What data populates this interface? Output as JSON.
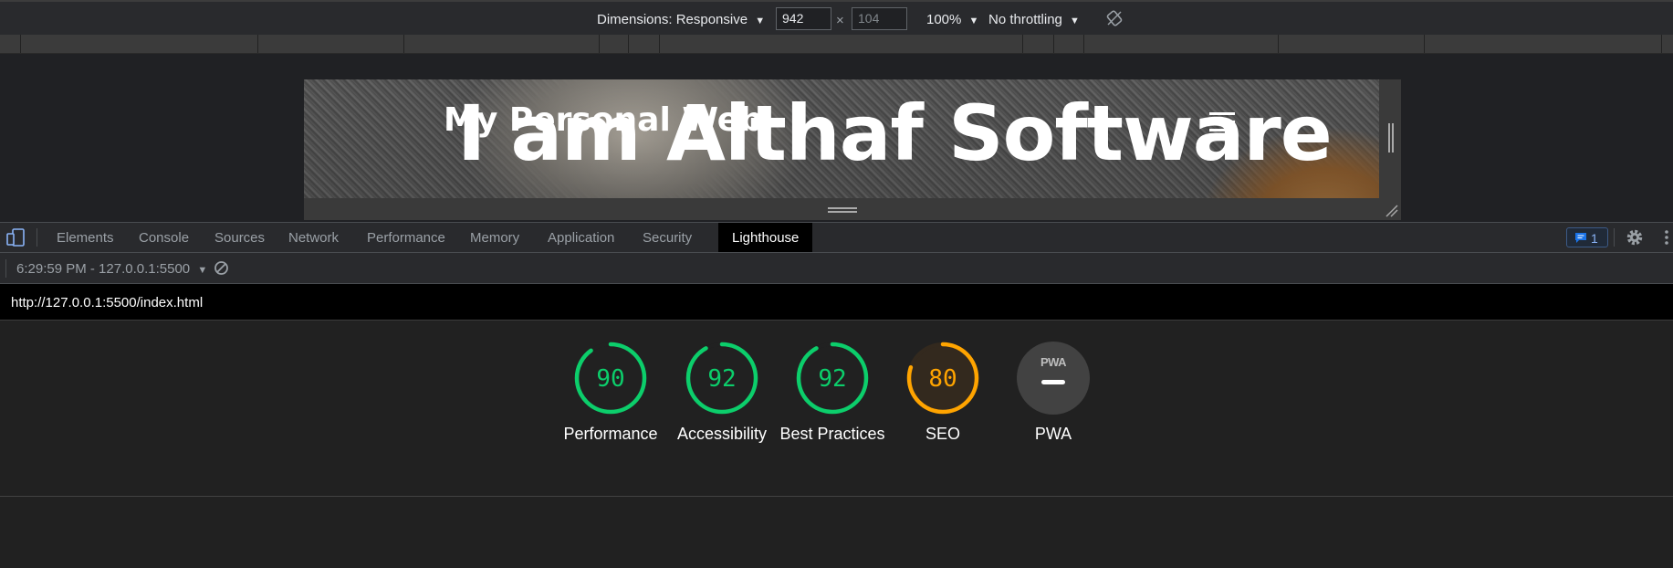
{
  "device_toolbar": {
    "dimensions_label": "Dimensions: Responsive",
    "width_value": "942",
    "times_symbol": "×",
    "height_placeholder": "104",
    "zoom": "100%",
    "throttling": "No throttling",
    "dropdown_arrow": "▼"
  },
  "page_preview": {
    "site_title": "My Personal Web",
    "hero_heading": "I am Althaf Software"
  },
  "devtools": {
    "tabs": [
      {
        "label": "Elements"
      },
      {
        "label": "Console"
      },
      {
        "label": "Sources"
      },
      {
        "label": "Network"
      },
      {
        "label": "Performance"
      },
      {
        "label": "Memory"
      },
      {
        "label": "Application"
      },
      {
        "label": "Security"
      },
      {
        "label": "Lighthouse"
      }
    ],
    "active_tab": "Lighthouse",
    "issues_count": "1"
  },
  "lighthouse": {
    "report_selector": "6:29:59 PM - 127.0.0.1:5500",
    "url": "http://127.0.0.1:5500/index.html",
    "scores": [
      {
        "label": "Performance",
        "value": 90,
        "display": "90",
        "color": "#0cce6b",
        "bg": "#212121"
      },
      {
        "label": "Accessibility",
        "value": 92,
        "display": "92",
        "color": "#0cce6b",
        "bg": "#212121"
      },
      {
        "label": "Best Practices",
        "value": 92,
        "display": "92",
        "color": "#0cce6b",
        "bg": "#212121"
      },
      {
        "label": "SEO",
        "value": 80,
        "display": "80",
        "color": "#ffa400",
        "bg": "#33291e"
      }
    ],
    "pwa": {
      "label": "PWA",
      "badge_text": "PWA"
    }
  }
}
